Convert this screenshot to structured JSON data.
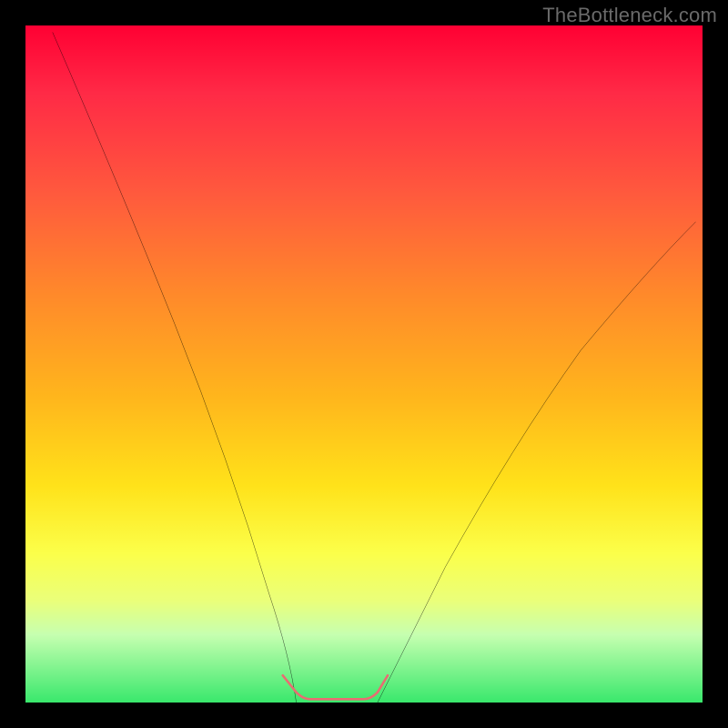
{
  "watermark": "TheBottleneck.com",
  "chart_data": {
    "type": "line",
    "title": "",
    "xlabel": "",
    "ylabel": "",
    "xlim": [
      0,
      100
    ],
    "ylim": [
      0,
      100
    ],
    "grid": false,
    "legend": false,
    "series": [
      {
        "name": "left-curve",
        "stroke": "#000000",
        "x": [
          4,
          8,
          12,
          16,
          20,
          24,
          28,
          32,
          35,
          38,
          40
        ],
        "values": [
          99,
          89,
          78,
          67,
          56,
          45,
          34,
          23,
          13,
          5,
          0
        ]
      },
      {
        "name": "right-curve",
        "stroke": "#000000",
        "x": [
          52,
          55,
          58,
          62,
          66,
          70,
          75,
          80,
          85,
          90,
          95,
          99
        ],
        "values": [
          0,
          4,
          9,
          16,
          23,
          30,
          38,
          46,
          53,
          60,
          66,
          71
        ]
      },
      {
        "name": "bottom-band",
        "stroke": "#e86d72",
        "x": [
          38,
          40,
          42,
          44,
          46,
          48,
          50,
          52
        ],
        "values": [
          4,
          1.5,
          0.5,
          0.5,
          0.5,
          0.5,
          1.5,
          4
        ]
      }
    ],
    "colors": {
      "gradient_top": "#ff0033",
      "gradient_bottom": "#39e86c",
      "curve": "#000000",
      "band": "#e86d72",
      "frame": "#000000"
    }
  }
}
